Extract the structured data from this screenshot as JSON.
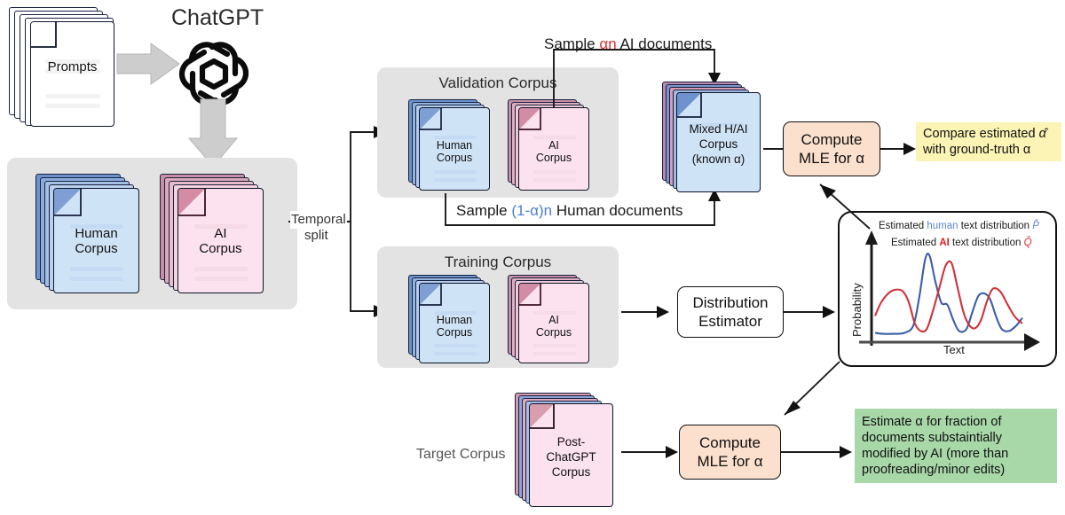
{
  "source": {
    "prompts_label": "Prompts",
    "chatgpt_label": "ChatGPT",
    "chatgpt_icon": "openai-knot-logo",
    "arrow_prompts_to_chatgpt": "thick-grey-right-arrow",
    "arrow_chatgpt_to_corpora": "thick-grey-down-arrow"
  },
  "base_corpus": {
    "human_label_line1": "Human",
    "human_label_line2": "Corpus",
    "ai_label_line1": "AI",
    "ai_label_line2": "Corpus"
  },
  "split": {
    "label_line1": "Temporal",
    "label_line2": "split"
  },
  "validation": {
    "title": "Validation Corpus",
    "human_label_line1": "Human",
    "human_label_line2": "Corpus",
    "ai_label_line1": "AI",
    "ai_label_line2": "Corpus"
  },
  "training": {
    "title": "Training Corpus",
    "human_label_line1": "Human",
    "human_label_line2": "Corpus",
    "ai_label_line1": "AI",
    "ai_label_line2": "Corpus"
  },
  "sampling": {
    "ai_note_prefix": "Sample ",
    "ai_note_math": "αn",
    "ai_note_suffix": " AI documents",
    "human_note_prefix": "Sample ",
    "human_note_math": "(1-α)n",
    "human_note_suffix": " Human documents"
  },
  "mixed_corpus": {
    "line1": "Mixed H/AI",
    "line2": "Corpus",
    "line3": "(known α)"
  },
  "target_corpus": {
    "section_label": "Target Corpus",
    "line1": "Post-",
    "line2": "ChatGPT",
    "line3": "Corpus"
  },
  "mle_top": {
    "line1": "Compute",
    "line2": "MLE for α"
  },
  "mle_bottom": {
    "line1": "Compute",
    "line2": "MLE for α"
  },
  "estimator": {
    "line1": "Distribution",
    "line2": "Estimator"
  },
  "compare_box": {
    "line1_prefix": "Compare estimated ",
    "line1_math": "α̂",
    "line2": "with ground-truth α"
  },
  "estimate_box": {
    "line1": "Estimate α for fraction of",
    "line2": "documents substaintially",
    "line3": "modified by AI (more than",
    "line4": "proofreading/minor edits)"
  },
  "colors": {
    "human_fill": "#cfe3f7",
    "human_stroke": "#16213c",
    "human_accent": "#6e92cd",
    "ai_fill": "#fbe2ee",
    "ai_stroke": "#3a1020",
    "ai_accent": "#d79aaf",
    "peach": "#fbe0cd",
    "panel_grey": "#e3e3e3",
    "yellow": "#fbf4b4",
    "green": "#a8d7a8",
    "human_curve": "#3b5ea8",
    "ai_curve": "#d0323a",
    "arrow_grey": "#cdcdcd"
  },
  "chart_data": {
    "type": "line",
    "title": "",
    "xlabel": "Text",
    "ylabel": "Probability",
    "grid": false,
    "legend_position": "top",
    "legend": [
      {
        "prefix": "Estimated ",
        "keyword": "human",
        "suffix": " text distribution ",
        "symbol": "P̂",
        "color": "#5b86d6"
      },
      {
        "prefix": "Estimated ",
        "keyword": "AI",
        "suffix": " text distribution ",
        "symbol": "Q̂",
        "color": "#e11b1b"
      }
    ],
    "xlim": [
      0,
      1
    ],
    "ylim": [
      0,
      1
    ],
    "series": [
      {
        "name": "Estimated human text distribution",
        "color": "#3b5ea8",
        "x": [
          0.0,
          0.05,
          0.12,
          0.2,
          0.26,
          0.3,
          0.34,
          0.37,
          0.41,
          0.45,
          0.49,
          0.53,
          0.57,
          0.62,
          0.66,
          0.7,
          0.74,
          0.78,
          0.82,
          0.86,
          0.91,
          0.96,
          1.0
        ],
        "y": [
          0.08,
          0.07,
          0.07,
          0.08,
          0.16,
          0.46,
          0.86,
          0.9,
          0.62,
          0.4,
          0.38,
          0.22,
          0.1,
          0.12,
          0.3,
          0.47,
          0.5,
          0.44,
          0.26,
          0.12,
          0.1,
          0.16,
          0.24
        ]
      },
      {
        "name": "Estimated AI text distribution",
        "color": "#d0323a",
        "x": [
          0.0,
          0.04,
          0.09,
          0.14,
          0.19,
          0.23,
          0.27,
          0.31,
          0.35,
          0.39,
          0.44,
          0.48,
          0.52,
          0.56,
          0.6,
          0.64,
          0.68,
          0.72,
          0.76,
          0.8,
          0.85,
          0.9,
          0.95,
          1.0
        ],
        "y": [
          0.26,
          0.4,
          0.5,
          0.54,
          0.52,
          0.4,
          0.18,
          0.1,
          0.12,
          0.3,
          0.58,
          0.8,
          0.82,
          0.56,
          0.3,
          0.16,
          0.13,
          0.22,
          0.42,
          0.55,
          0.52,
          0.38,
          0.25,
          0.18
        ]
      }
    ]
  }
}
